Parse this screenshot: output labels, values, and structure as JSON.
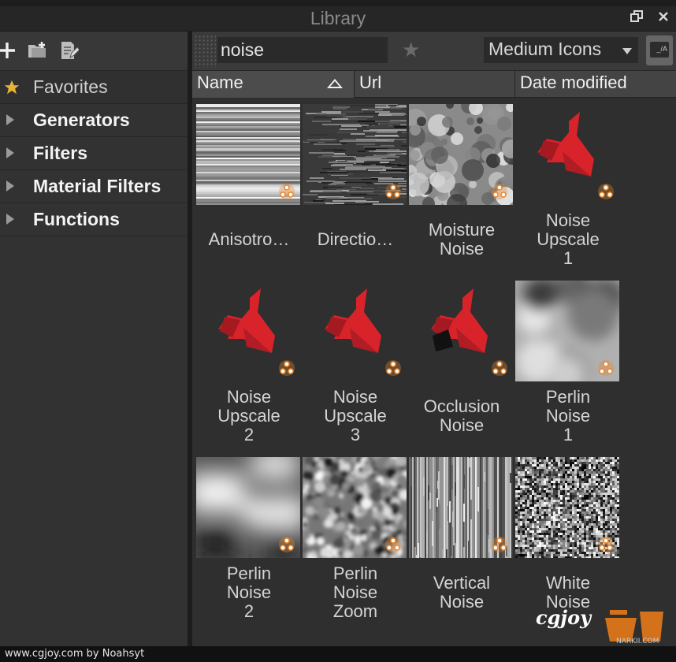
{
  "window": {
    "title": "Library",
    "buttons": {
      "restore_icon": "restore-window-icon",
      "close_icon": "close-icon"
    }
  },
  "toolbar": {
    "icons": [
      "plus-icon",
      "add-folder-icon",
      "edit-document-icon"
    ]
  },
  "tree": [
    {
      "label": "Favorites",
      "icon": "star-icon"
    },
    {
      "label": "Generators",
      "icon": "expand-arrow-icon"
    },
    {
      "label": "Filters",
      "icon": "expand-arrow-icon"
    },
    {
      "label": "Material Filters",
      "icon": "expand-arrow-icon"
    },
    {
      "label": "Functions",
      "icon": "expand-arrow-icon"
    }
  ],
  "search": {
    "value": "noise"
  },
  "view_mode": {
    "selected": "Medium Icons"
  },
  "columns": {
    "name": "Name",
    "url": "Url",
    "date": "Date modified"
  },
  "items": [
    {
      "label": "Anisotro…",
      "thumb": "horizontal-streak-noise"
    },
    {
      "label": "Directio…",
      "thumb": "directional-noise"
    },
    {
      "label": "Moisture Noise",
      "thumb": "moisture-noise"
    },
    {
      "label": "Noise Upscale 1",
      "thumb": "substance-logo"
    },
    {
      "label": "Noise Upscale 2",
      "thumb": "substance-logo"
    },
    {
      "label": "Noise Upscale 3",
      "thumb": "substance-logo"
    },
    {
      "label": "Occlusion Noise",
      "thumb": "substance-logo-dark"
    },
    {
      "label": "Perlin Noise 1",
      "thumb": "perlin-noise"
    },
    {
      "label": "Perlin Noise 2",
      "thumb": "perlin-noise-large"
    },
    {
      "label": "Perlin Noise Zoom",
      "thumb": "perlin-noise-fine"
    },
    {
      "label": "Vertical Noise",
      "thumb": "vertical-streak-noise"
    },
    {
      "label": "White Noise",
      "thumb": "white-noise"
    }
  ],
  "colors": {
    "accent_red": "#d8232a",
    "badge_orange": "#e9862a"
  },
  "footer": {
    "text": "www.cgjoy.com by Noahsyt"
  },
  "watermark": {
    "text": "cgjoy",
    "sub": "NARKII.COM"
  }
}
